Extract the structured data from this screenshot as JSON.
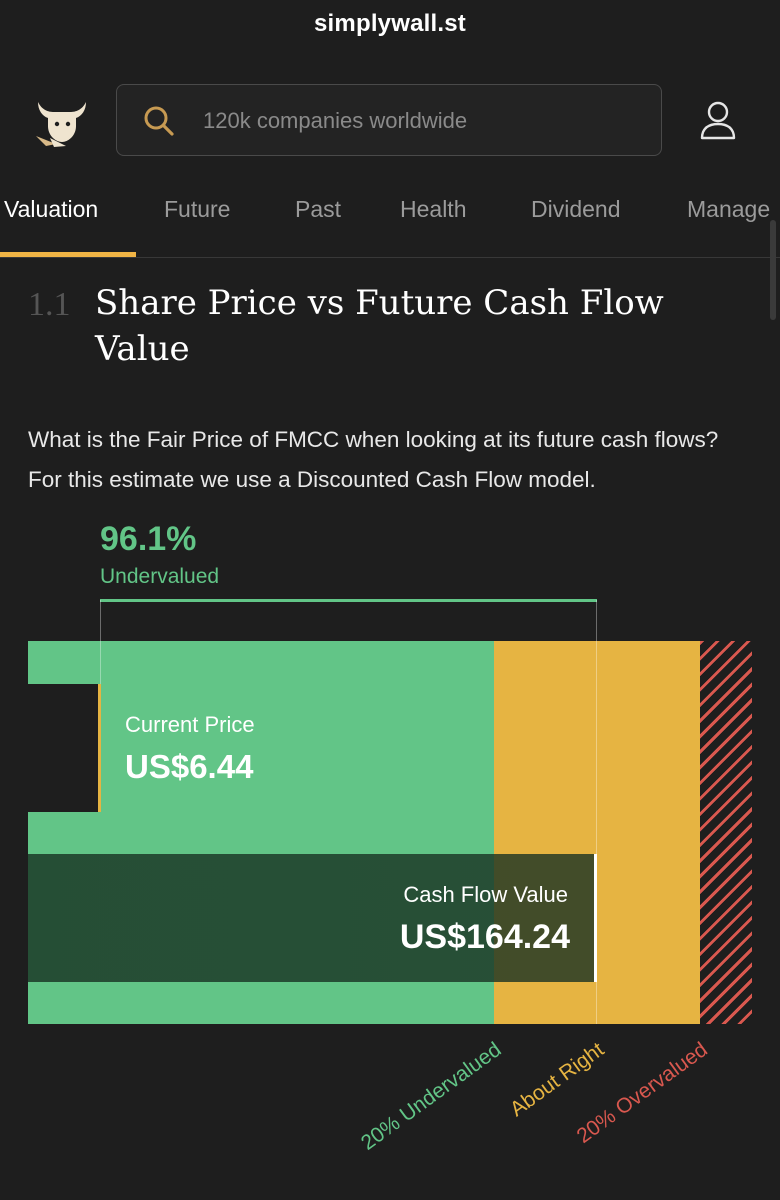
{
  "header": {
    "site_title": "simplywall.st",
    "logo_icon": "bull-logo-icon",
    "search": {
      "placeholder": "120k companies worldwide"
    },
    "user_icon": "user-icon"
  },
  "tabs": [
    {
      "label": "Valuation",
      "active": true
    },
    {
      "label": "Future",
      "active": false
    },
    {
      "label": "Past",
      "active": false
    },
    {
      "label": "Health",
      "active": false
    },
    {
      "label": "Dividend",
      "active": false
    },
    {
      "label": "Manage",
      "active": false
    }
  ],
  "section": {
    "number": "1.1",
    "title": "Share Price vs Future Cash Flow Value",
    "description": "What is the Fair Price of FMCC when looking at its future cash flows? For this estimate we use a Discounted Cash Flow model."
  },
  "valuation_chart": {
    "undervalued_pct": "96.1%",
    "undervalued_label": "Undervalued",
    "current_price_label": "Current Price",
    "current_price": "US$6.44",
    "cash_flow_value_label": "Cash Flow Value",
    "cash_flow_value": "US$164.24",
    "zones": {
      "undervalued": "20% Undervalued",
      "about_right": "About Right",
      "overvalued": "20% Overvalued"
    },
    "colors": {
      "undervalued": "#62c587",
      "about_right": "#e6b442",
      "overvalued": "#d9584f",
      "accent": "#f0b445"
    }
  }
}
